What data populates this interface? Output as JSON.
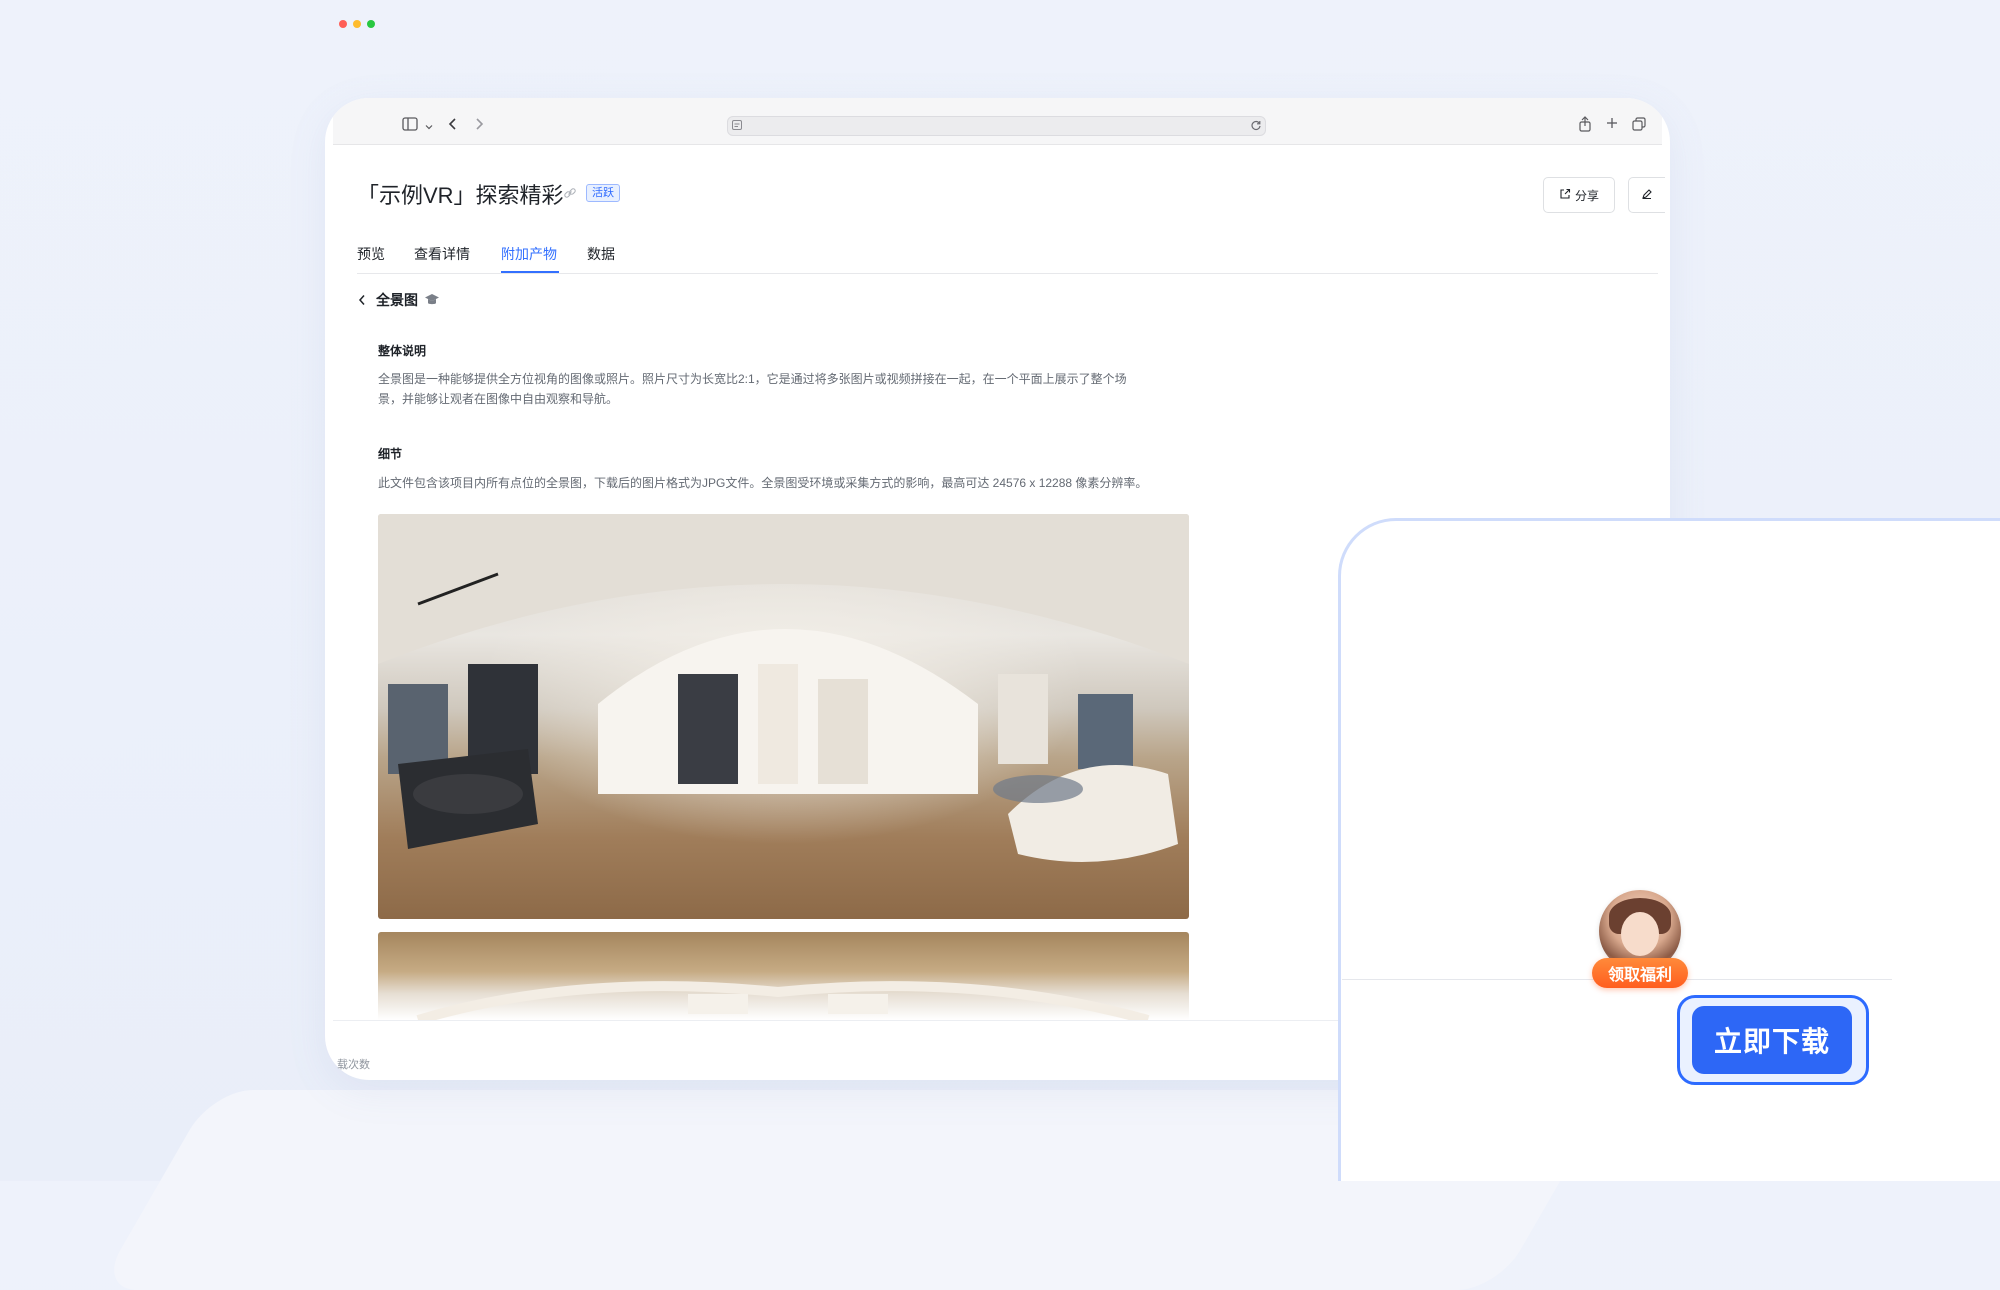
{
  "header": {
    "title": "「示例VR」探索精彩",
    "status_badge": "活跃",
    "share_label": "分享"
  },
  "tabs": [
    {
      "label": "预览"
    },
    {
      "label": "查看详情"
    },
    {
      "label": "附加产物",
      "active": true
    },
    {
      "label": "数据"
    }
  ],
  "breadcrumb": {
    "label": "全景图"
  },
  "overview": {
    "heading": "整体说明",
    "text_line1": "全景图是一种能够提供全方位视角的图像或照片。照片尺寸为长宽比2:1，它是通过将多张图片或视频拼接在一起，在一个平面上展示了整个场",
    "text_line2": "景，并能够让观者在图像中自由观察和导航。"
  },
  "details": {
    "heading": "细节",
    "text": "此文件包含该项目内所有点位的全景图，下载后的图片格式为JPG文件。全景图受环境或采集方式的影响，最高可达 24576 x 12288 像素分辨率。"
  },
  "footer": {
    "partial_label": "载次数"
  },
  "promo": {
    "benefit_label": "领取福利",
    "download_label": "立即下载"
  },
  "colors": {
    "accent": "#3370ff",
    "download_button": "#2d67f6",
    "benefit_pill": "#ff6a25"
  },
  "icons": [
    "sidebar-icon",
    "chevron-left-icon",
    "chevron-right-icon",
    "share-icon",
    "plus-icon",
    "tabs-icon",
    "reload-icon",
    "edit-icon",
    "link-icon",
    "graduation-cap-icon"
  ]
}
